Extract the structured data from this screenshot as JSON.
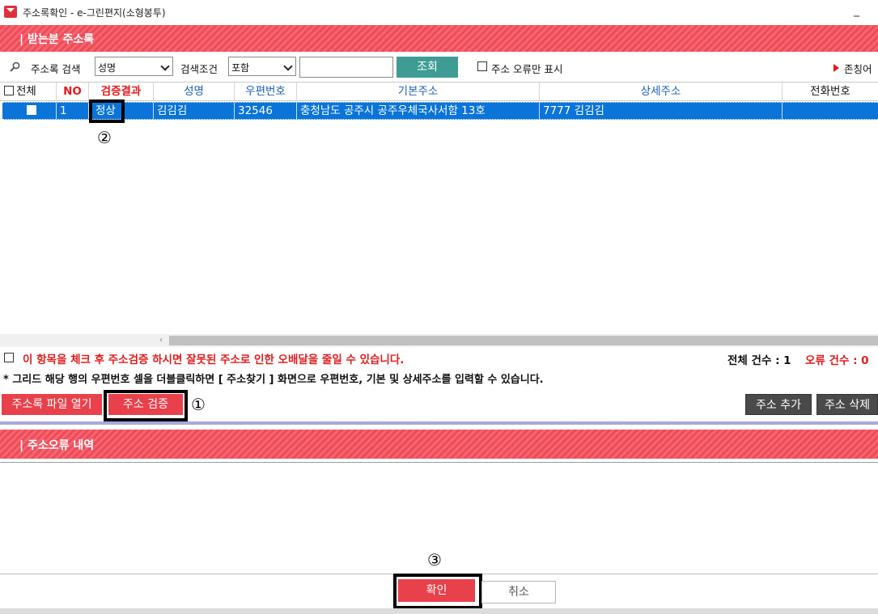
{
  "window": {
    "title": "주소록확인 - e-그린편지(소형봉투)",
    "minimize_glyph": "_"
  },
  "address_book": {
    "header": "| 받는분 주소록",
    "search": {
      "label": "주소록 검색",
      "field_select": "성명",
      "condition_label": "검색조건",
      "condition_select": "포함",
      "input_value": "",
      "search_button": "조회",
      "error_only_label": "주소 오류만 표시",
      "honorific_label": "존칭어"
    },
    "columns": [
      "전체",
      "NO",
      "검증결과",
      "성명",
      "우편번호",
      "기본주소",
      "상세주소",
      "전화번호"
    ],
    "rows": [
      {
        "no": "1",
        "result": "정상",
        "name": "김김김",
        "zip": "32546",
        "base_address": "충청남도 공주시 공주우체국사서함 13호",
        "detail_address": "7777 김김김",
        "phone": ""
      }
    ],
    "warning": "이 항목을 체크 후 주소검증 하시면 잘못된 주소로 인한 오배달을 줄일 수 있습니다.",
    "note": "* 그리드 해당 행의 우편번호 셀을 더블클릭하면 [ 주소찾기 ] 화면으로 우편번호, 기본 및 상세주소를 입력할 수 있습니다.",
    "total_count": "전체 건수 : 1",
    "error_count": "오류 건수 : 0",
    "buttons": {
      "open_file": "주소록 파일 열기",
      "verify": "주소 검증",
      "add": "주소 추가",
      "delete": "주소 삭제"
    }
  },
  "error_section": {
    "header": "| 주소오류 내역"
  },
  "footer": {
    "ok": "확인",
    "cancel": "취소"
  },
  "annotations": {
    "step1": "①",
    "step2": "②",
    "step3": "③"
  },
  "colors": {
    "accent_red": "#e8414b",
    "selection_blue": "#0a74d8",
    "search_teal": "#3f9c94",
    "header_blue_text": "#1a5fb8"
  }
}
